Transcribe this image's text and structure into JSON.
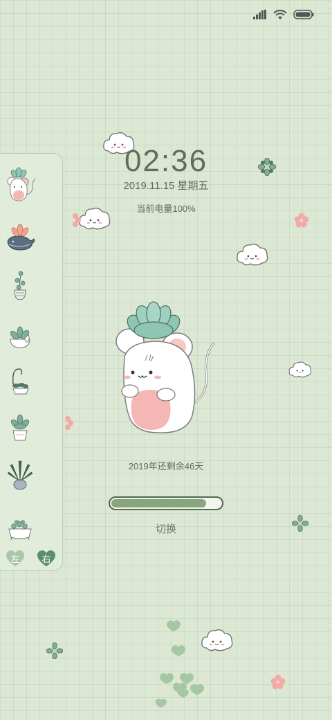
{
  "status_bar": {
    "icons": [
      "signal-icon",
      "wifi-icon",
      "battery-icon"
    ]
  },
  "lockscreen": {
    "time": "02:36",
    "date": "2019.11.15 星期五",
    "battery_text": "当前电量100%",
    "remaining_text": "2019年还剩余46天",
    "progress_fraction": 0.87,
    "switch_label": "切换"
  },
  "side_panel": {
    "items": [
      {
        "icon": "mouse-succulent-icon"
      },
      {
        "icon": "whale-planter-icon"
      },
      {
        "icon": "hanging-plant-icon"
      },
      {
        "icon": "bunny-planter-icon"
      },
      {
        "icon": "hook-plant-icon"
      },
      {
        "icon": "potted-succulent-icon"
      },
      {
        "icon": "aloe-pot-icon"
      },
      {
        "icon": "tub-planter-icon"
      }
    ],
    "left_label": "左",
    "right_label": "右"
  },
  "colors": {
    "background": "#dde8d4",
    "text": "#5e6e59",
    "progress_fill": "#88a57f",
    "progress_border": "#4f6a4c",
    "heart_left": "#a7c7a5",
    "heart_right": "#5b8f68"
  }
}
